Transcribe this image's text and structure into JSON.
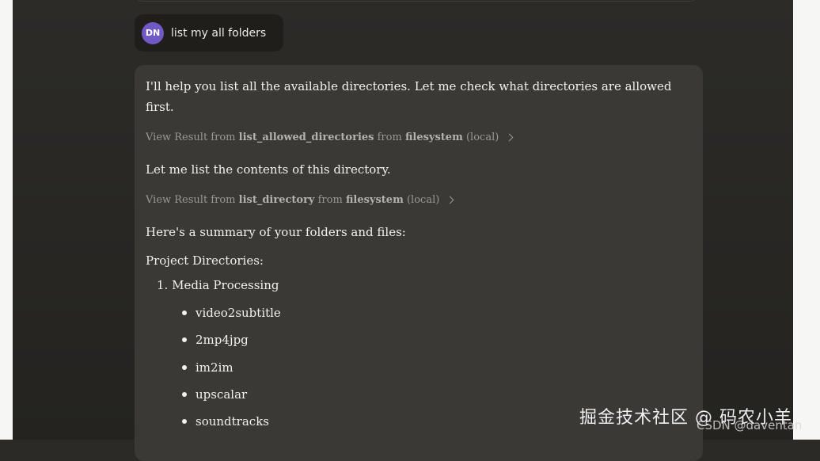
{
  "user_message": {
    "avatar_initials": "DN",
    "text": "list my all folders"
  },
  "assistant": {
    "intro_line1": "I'll help you list all the available directories. Let me check what directories are allowed",
    "intro_line2": "first.",
    "tool_call_1": {
      "prefix": "View Result from",
      "tool": "list_allowed_directories",
      "from_label": "from",
      "server": "filesystem",
      "scope": "(local)"
    },
    "line_2": "Let me list the contents of this directory.",
    "tool_call_2": {
      "prefix": "View Result from",
      "tool": "list_directory",
      "from_label": "from",
      "server": "filesystem",
      "scope": "(local)"
    },
    "summary": "Here's a summary of your folders and files:",
    "section_title": "Project Directories:",
    "numbered_item": "1. Media Processing",
    "bullets": [
      "video2subtitle",
      "2mp4jpg",
      "im2im",
      "upscalar",
      "soundtracks"
    ]
  },
  "watermark": {
    "main": "掘金技术社区 @ 码农小羊",
    "sub": "CSDN @daventan"
  },
  "colors": {
    "background": "#2b2a27",
    "bubble": "#3a3936",
    "avatar": "#7059c4",
    "text": "#f2f1ec",
    "muted": "#9a9893"
  },
  "scrollbar": {
    "thumb_position_fraction": 0.75
  }
}
